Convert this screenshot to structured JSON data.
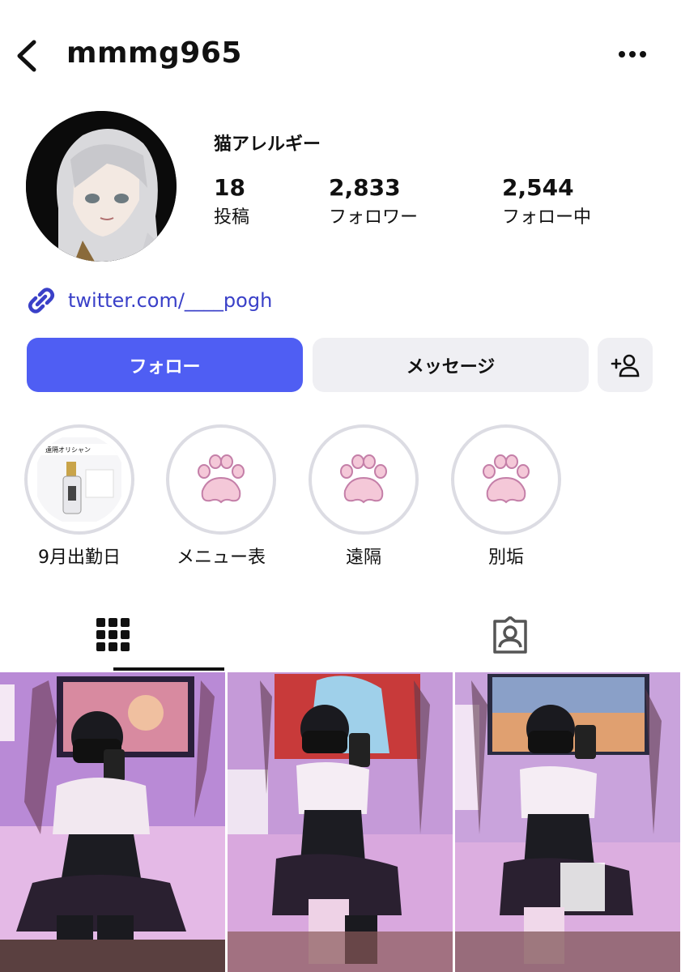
{
  "header": {
    "username": "mmmg965",
    "back_icon": "chevron-left-icon",
    "more_icon": "more-horizontal-icon"
  },
  "profile": {
    "display_name": "猫アレルギー",
    "stats": [
      {
        "value": "18",
        "label": "投稿"
      },
      {
        "value": "2,833",
        "label": "フォロワー"
      },
      {
        "value": "2,544",
        "label": "フォロー中"
      }
    ],
    "link_text": "twitter.com/____pogh"
  },
  "actions": {
    "follow_label": "フォロー",
    "message_label": "メッセージ",
    "add_user_icon": "person-plus-icon"
  },
  "highlights": [
    {
      "label": "9月出勤日",
      "thumb_text": "遠隔オリシャン"
    },
    {
      "label": "メニュー表"
    },
    {
      "label": "遠隔"
    },
    {
      "label": "別垢"
    }
  ],
  "tabs": {
    "grid_icon": "grid-icon",
    "tagged_icon": "tagged-person-icon"
  },
  "colors": {
    "accent": "#4f5ef3",
    "link": "#3a40c8",
    "button_gray": "#efeff3",
    "paw_pink": "#f4c8d8"
  }
}
